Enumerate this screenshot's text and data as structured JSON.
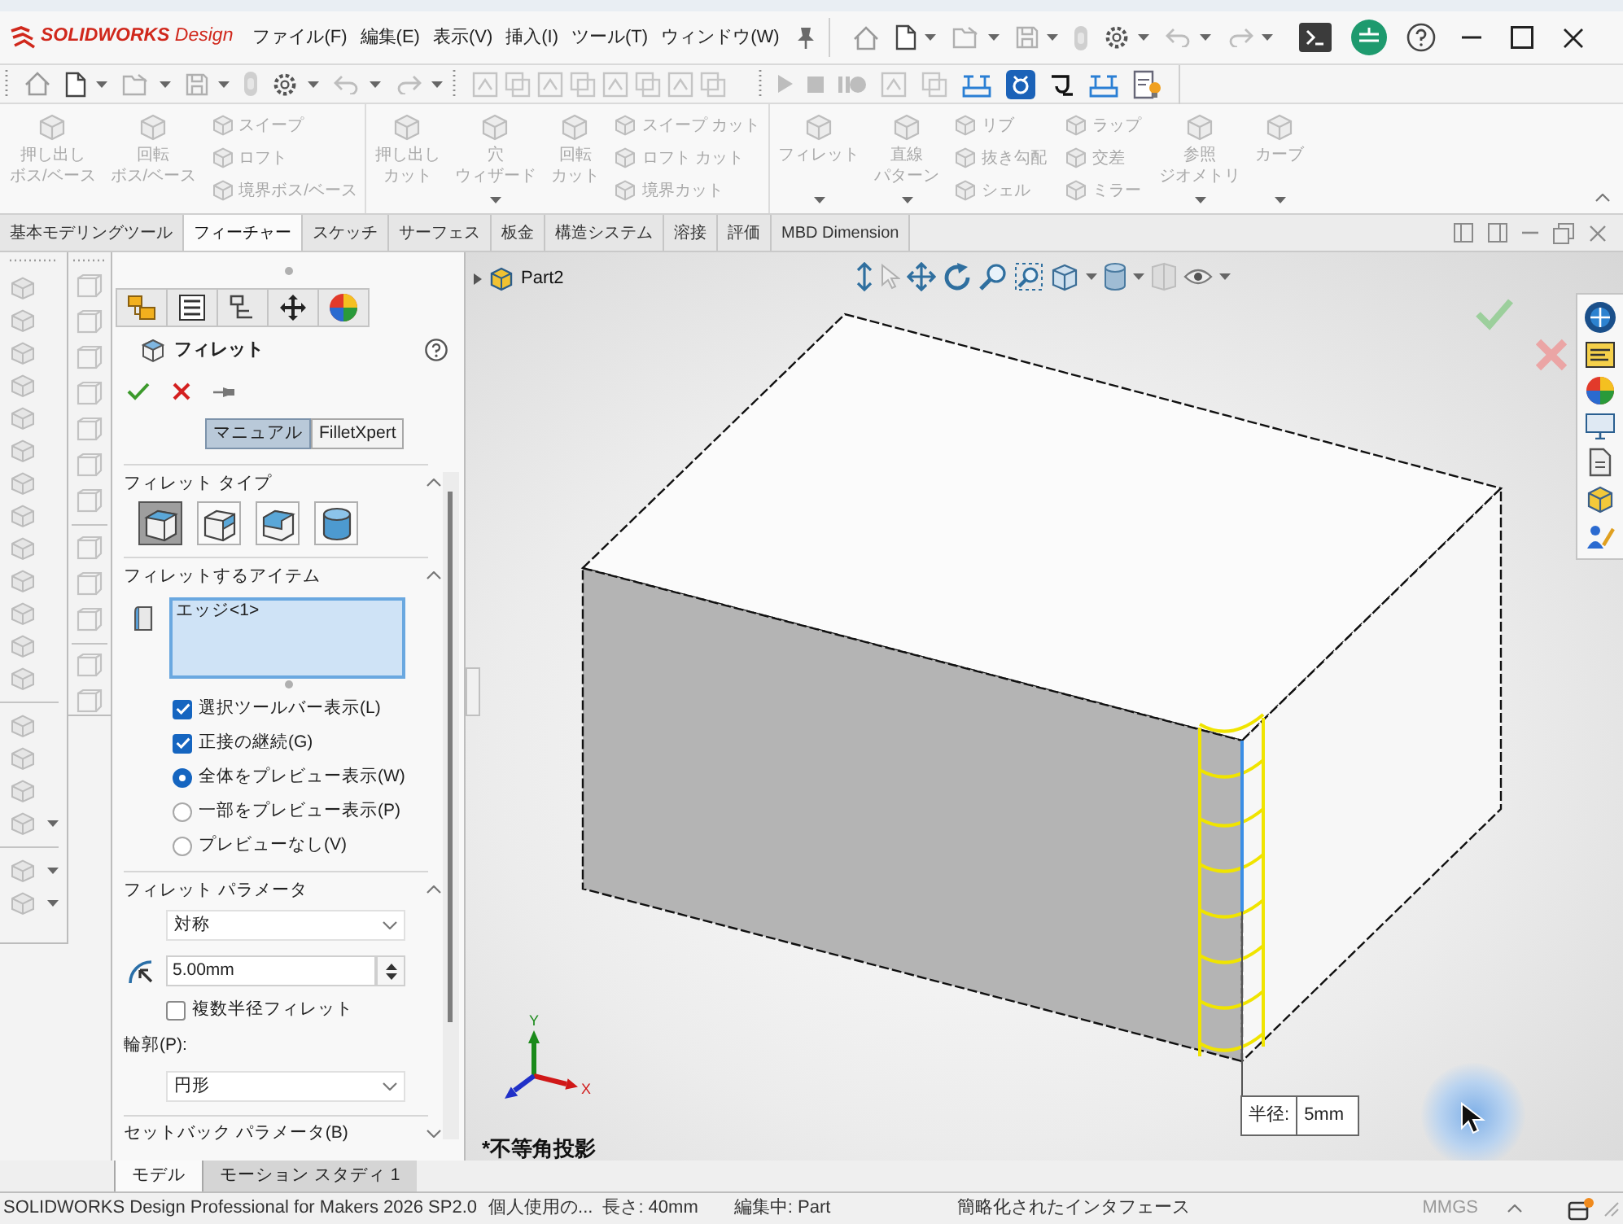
{
  "title_bar": {
    "logo": "**SOLIDWORKS** Design",
    "menus": [
      "ファイル(F)",
      "編集(E)",
      "表示(V)",
      "挿入(I)",
      "ツール(T)",
      "ウィンドウ(W)"
    ]
  },
  "command_manager": {
    "groups": [
      {
        "items": [
          {
            "kind": "large",
            "lines": [
              "押し出し",
              "ボス/ベース"
            ],
            "dropdown": false,
            "disabled": true
          },
          {
            "kind": "large",
            "lines": [
              "回転",
              "ボス/ベース"
            ],
            "dropdown": false,
            "disabled": true
          },
          {
            "kind": "stack",
            "items": [
              {
                "label": "スイープ",
                "disabled": true
              },
              {
                "label": "ロフト",
                "disabled": true
              },
              {
                "label": "境界ボス/ベース",
                "disabled": true
              }
            ]
          }
        ]
      },
      {
        "items": [
          {
            "kind": "large",
            "lines": [
              "押し出し",
              "カット"
            ],
            "dropdown": false,
            "disabled": true
          },
          {
            "kind": "large",
            "lines": [
              "穴",
              "ウィザード"
            ],
            "dropdown": true,
            "disabled": true
          },
          {
            "kind": "large",
            "lines": [
              "回転",
              "カット"
            ],
            "dropdown": false,
            "disabled": true
          },
          {
            "kind": "stack",
            "items": [
              {
                "label": "スイープ カット",
                "disabled": true
              },
              {
                "label": "ロフト カット",
                "disabled": true
              },
              {
                "label": "境界カット",
                "disabled": true
              }
            ]
          }
        ]
      },
      {
        "items": [
          {
            "kind": "large",
            "lines": [
              "フィレット"
            ],
            "dropdown": true,
            "disabled": true
          },
          {
            "kind": "large",
            "lines": [
              "直線",
              "パターン"
            ],
            "dropdown": true,
            "disabled": true
          },
          {
            "kind": "stack",
            "items": [
              {
                "label": "リブ",
                "disabled": true
              },
              {
                "label": "抜き勾配",
                "disabled": true
              },
              {
                "label": "シェル",
                "disabled": true
              }
            ]
          },
          {
            "kind": "stack",
            "items": [
              {
                "label": "ラップ",
                "disabled": true
              },
              {
                "label": "交差",
                "disabled": true
              },
              {
                "label": "ミラー",
                "disabled": true
              }
            ]
          },
          {
            "kind": "large",
            "lines": [
              "参照",
              "ジオメトリ"
            ],
            "dropdown": true,
            "disabled": true
          },
          {
            "kind": "large",
            "lines": [
              "カーブ"
            ],
            "dropdown": true,
            "disabled": true
          }
        ]
      }
    ]
  },
  "ribbon_tabs": [
    {
      "label": "基本モデリングツール",
      "selected": false
    },
    {
      "label": "フィーチャー",
      "selected": true
    },
    {
      "label": "スケッチ",
      "selected": false
    },
    {
      "label": "サーフェス",
      "selected": false
    },
    {
      "label": "板金",
      "selected": false
    },
    {
      "label": "構造システム",
      "selected": false
    },
    {
      "label": "溶接",
      "selected": false
    },
    {
      "label": "評価",
      "selected": false
    },
    {
      "label": "MBD Dimension",
      "selected": false
    }
  ],
  "property_manager": {
    "title": "フィレット",
    "modes": [
      {
        "label": "マニュアル",
        "selected": true
      },
      {
        "label": "FilletXpert",
        "selected": false
      }
    ],
    "sections": [
      {
        "kind": "fillet_type",
        "title": "フィレット タイプ",
        "expanded": true,
        "options": [
          {
            "selected": true
          },
          {
            "selected": false
          },
          {
            "selected": false
          },
          {
            "selected": false
          }
        ]
      },
      {
        "kind": "items",
        "title": "フィレットするアイテム",
        "expanded": true,
        "selection": [
          "エッジ<1>"
        ],
        "options": [
          {
            "kind": "checkbox",
            "label": "選択ツールバー表示(L)",
            "checked": true
          },
          {
            "kind": "checkbox",
            "label": "正接の継続(G)",
            "checked": true
          },
          {
            "kind": "radio",
            "label": "全体をプレビュー表示(W)",
            "selected": true
          },
          {
            "kind": "radio",
            "label": "一部をプレビュー表示(P)",
            "selected": false
          },
          {
            "kind": "radio",
            "label": "プレビューなし(V)",
            "selected": false
          }
        ]
      },
      {
        "kind": "parameters",
        "title": "フィレット パラメータ",
        "expanded": true,
        "method": "対称",
        "radius": "5.00mm",
        "multi_radius": {
          "label": "複数半径フィレット",
          "checked": false
        },
        "profile_label": "輪郭(P):",
        "profile": "円形"
      },
      {
        "kind": "setback",
        "title": "セットバック パラメータ(B)",
        "expanded": false
      }
    ]
  },
  "viewport": {
    "tree_root": "Part2",
    "dimension": {
      "label": "半径:",
      "value": "5mm"
    },
    "triad_labels": [
      "Y",
      "X"
    ],
    "view_label": "*不等角投影"
  },
  "bottom_tabs": [
    {
      "label": "モデル",
      "selected": true
    },
    {
      "label": "モーション スタディ 1",
      "selected": false
    }
  ],
  "status_bar": {
    "fields": [
      "SOLIDWORKS Design Professional for Makers 2026 SP2.0",
      "個人使用の...",
      "長さ: 40mm",
      "編集中: Part",
      "簡略化されたインタフェース"
    ],
    "units": "MMGS"
  }
}
